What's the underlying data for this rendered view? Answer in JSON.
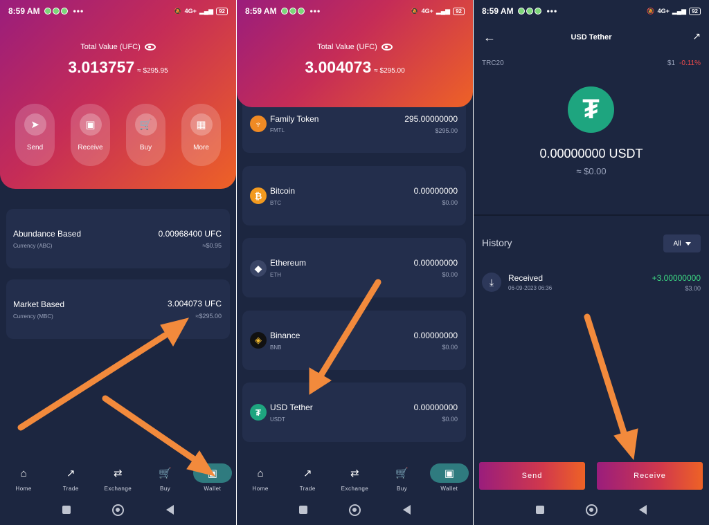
{
  "status": {
    "time": "8:59 AM",
    "more": "•••",
    "network": "4G+",
    "battery": "92"
  },
  "panel1": {
    "total_label": "Total Value (UFC)",
    "total_amount": "3.013757",
    "total_fiat": "≈ $295.95",
    "actions": [
      {
        "label": "Send",
        "icon": "send-icon"
      },
      {
        "label": "Receive",
        "icon": "wallet-icon"
      },
      {
        "label": "Buy",
        "icon": "cart-icon"
      },
      {
        "label": "More",
        "icon": "grid-icon"
      }
    ],
    "cards": [
      {
        "title": "Abundance Based",
        "sub": "Currency (ABC)",
        "amount": "0.00968400 UFC",
        "fiat": "≈$0.95"
      },
      {
        "title": "Market Based",
        "sub": "Currency (MBC)",
        "amount": "3.004073 UFC",
        "fiat": "≈$295.00"
      }
    ]
  },
  "panel2": {
    "total_label": "Total Value (UFC)",
    "total_amount": "3.004073",
    "total_fiat": "≈ $295.00",
    "tokens": [
      {
        "name": "Family Token",
        "symbol": "FMTL",
        "amount": "295.00000000",
        "fiat": "$295.00",
        "color": "#f08a24"
      },
      {
        "name": "Bitcoin",
        "symbol": "BTC",
        "amount": "0.00000000",
        "fiat": "$0.00",
        "color": "#f39a1f"
      },
      {
        "name": "Ethereum",
        "symbol": "ETH",
        "amount": "0.00000000",
        "fiat": "$0.00",
        "color": "#3a4566"
      },
      {
        "name": "Binance",
        "symbol": "BNB",
        "amount": "0.00000000",
        "fiat": "$0.00",
        "color": "#111111"
      },
      {
        "name": "USD Tether",
        "symbol": "USDT",
        "amount": "0.00000000",
        "fiat": "$0.00",
        "color": "#1ea57f"
      }
    ]
  },
  "panel3": {
    "title": "USD Tether",
    "network": "TRC20",
    "price": "$1",
    "change": "-0.11%",
    "balance": "0.00000000 USDT",
    "balance_fiat": "≈ $0.00",
    "history_label": "History",
    "filter": "All",
    "transactions": [
      {
        "type": "Received",
        "date": "06-09-2023 06:36",
        "amount": "+3.00000000",
        "fiat": "$3.00"
      }
    ],
    "send_label": "Send",
    "receive_label": "Receive"
  },
  "nav": [
    "Home",
    "Trade",
    "Exchange",
    "Buy",
    "Wallet"
  ],
  "colors": {
    "background": "#1c2640",
    "card": "#232e4c",
    "accent": "#f28a3c",
    "positive": "#3ddc84",
    "negative": "#ef4b4b"
  }
}
